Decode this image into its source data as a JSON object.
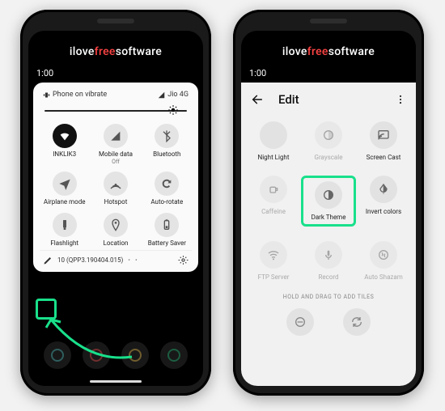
{
  "branding": {
    "pre": "ilove",
    "accent": "free",
    "post": "software"
  },
  "left": {
    "time": "1:00",
    "qs": {
      "top_status": "Phone on vibrate",
      "signal": "Jio 4G",
      "tiles": [
        {
          "label": "INKLIK3",
          "sub": "",
          "icon": "wifi",
          "active": true
        },
        {
          "label": "Mobile data",
          "sub": "Off",
          "icon": "cell",
          "active": false
        },
        {
          "label": "Bluetooth",
          "sub": "",
          "icon": "bt",
          "active": false
        },
        {
          "label": "Airplane mode",
          "sub": "",
          "icon": "plane",
          "active": false
        },
        {
          "label": "Hotspot",
          "sub": "",
          "icon": "hotspot",
          "active": false
        },
        {
          "label": "Auto-rotate",
          "sub": "",
          "icon": "rotate",
          "active": false
        },
        {
          "label": "Flashlight",
          "sub": "",
          "icon": "torch",
          "active": false
        },
        {
          "label": "Location",
          "sub": "",
          "icon": "pin",
          "active": false
        },
        {
          "label": "Battery Saver",
          "sub": "",
          "icon": "battery",
          "active": false
        }
      ],
      "build": "10 (QPP3.190404.015)"
    }
  },
  "right": {
    "time": "1:00",
    "header": {
      "title": "Edit"
    },
    "tiles": [
      {
        "label": "Night Light",
        "icon": "moon",
        "dim": false
      },
      {
        "label": "Grayscale",
        "icon": "gray",
        "dim": true
      },
      {
        "label": "Screen Cast",
        "icon": "cast",
        "dim": false
      },
      {
        "label": "Caffeine",
        "icon": "cup",
        "dim": true
      },
      {
        "label": "Dark Theme",
        "icon": "half",
        "dim": false,
        "highlight": true
      },
      {
        "label": "Invert colors",
        "icon": "invert",
        "dim": false
      },
      {
        "label": "FTP Server",
        "icon": "wifi2",
        "dim": true
      },
      {
        "label": "Record",
        "icon": "mic",
        "dim": true
      },
      {
        "label": "Auto Shazam",
        "icon": "shazam",
        "dim": true
      }
    ],
    "hint": "HOLD AND DRAG TO ADD TILES",
    "extra": [
      {
        "icon": "dnd"
      },
      {
        "icon": "sync"
      }
    ]
  },
  "colors": {
    "highlight": "#19e08b"
  }
}
